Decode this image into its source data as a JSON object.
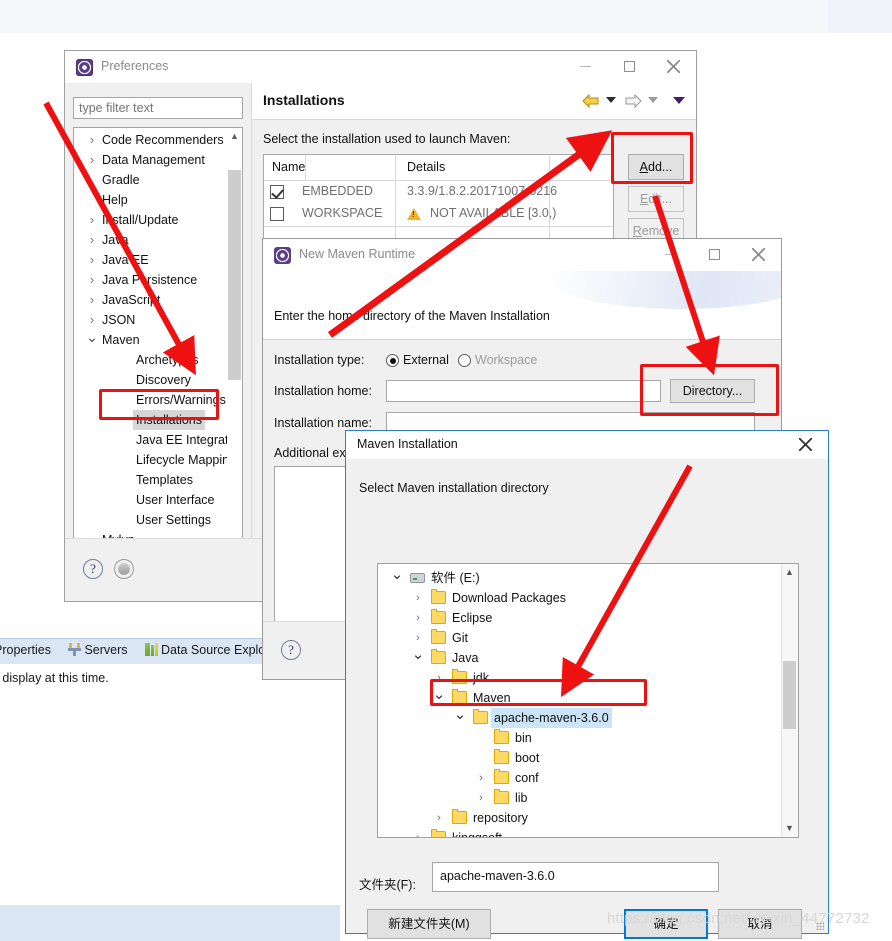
{
  "workbench": {
    "window_controls": [
      "restore-icon",
      "maximize-icon"
    ],
    "view_tabs": [
      {
        "label": "Properties",
        "icon": ""
      },
      {
        "label": "Servers",
        "icon": "servers-icon"
      },
      {
        "label": "Data Source Explo",
        "icon": "data-source-icon"
      }
    ],
    "view_message": "o display at this time."
  },
  "preferences": {
    "title": "Preferences",
    "icon": "preferences-icon",
    "filter_placeholder": "type filter text",
    "filter_value": "",
    "tree": [
      {
        "label": "Code Recommenders",
        "arrow": ">",
        "level": 1,
        "selected": false
      },
      {
        "label": "Data Management",
        "arrow": ">",
        "level": 1,
        "selected": false
      },
      {
        "label": "Gradle",
        "arrow": "",
        "level": 1,
        "selected": false
      },
      {
        "label": "Help",
        "arrow": "",
        "level": 1,
        "selected": false
      },
      {
        "label": "Install/Update",
        "arrow": ">",
        "level": 1,
        "selected": false
      },
      {
        "label": "Java",
        "arrow": ">",
        "level": 1,
        "selected": false
      },
      {
        "label": "Java EE",
        "arrow": ">",
        "level": 1,
        "selected": false
      },
      {
        "label": "Java Persistence",
        "arrow": ">",
        "level": 1,
        "selected": false
      },
      {
        "label": "JavaScript",
        "arrow": ">",
        "level": 1,
        "selected": false
      },
      {
        "label": "JSON",
        "arrow": ">",
        "level": 1,
        "selected": false
      },
      {
        "label": "Maven",
        "arrow": "v",
        "level": 1,
        "selected": false
      },
      {
        "label": "Archetypes",
        "arrow": "",
        "level": 2,
        "selected": false
      },
      {
        "label": "Discovery",
        "arrow": "",
        "level": 2,
        "selected": false
      },
      {
        "label": "Errors/Warnings",
        "arrow": "",
        "level": 2,
        "selected": false
      },
      {
        "label": "Installations",
        "arrow": "",
        "level": 2,
        "selected": true
      },
      {
        "label": "Java EE Integration",
        "arrow": "",
        "level": 2,
        "selected": false
      },
      {
        "label": "Lifecycle Mapping",
        "arrow": "",
        "level": 2,
        "selected": false
      },
      {
        "label": "Templates",
        "arrow": "",
        "level": 2,
        "selected": false
      },
      {
        "label": "User Interface",
        "arrow": "",
        "level": 2,
        "selected": false
      },
      {
        "label": "User Settings",
        "arrow": "",
        "level": 2,
        "selected": false
      },
      {
        "label": "Mylyn",
        "arrow": ">",
        "level": 1,
        "selected": false
      }
    ],
    "page": {
      "title": "Installations",
      "description": "Select the installation used to launch Maven:",
      "nav": {
        "back": "back-arrow-icon",
        "forward": "forward-arrow-icon",
        "menu": "dropdown-caret-icon"
      },
      "table": {
        "columns": [
          "Name",
          "Details"
        ],
        "rows": [
          {
            "checked": true,
            "name": "EMBEDDED",
            "details": "3.3.9/1.8.2.20171007-0216",
            "warning": false
          },
          {
            "checked": false,
            "name": "WORKSPACE",
            "details": "NOT AVAILABLE [3.0,)",
            "warning": true
          }
        ]
      },
      "buttons": [
        {
          "label": "Add...",
          "mnemonic": "A",
          "enabled": true
        },
        {
          "label": "Edit...",
          "mnemonic": "E",
          "enabled": false
        },
        {
          "label": "Remove",
          "mnemonic": "R",
          "enabled": false
        }
      ]
    },
    "footer": {
      "help": "?",
      "apply": "apply-icon"
    }
  },
  "new_maven_runtime": {
    "title": "New Maven Runtime",
    "icon": "maven-runtime-icon",
    "message": "Enter the home directory of the Maven Installation",
    "fields": {
      "installation_type_label": "Installation type:",
      "radio_external": "External",
      "radio_workspace": "Workspace",
      "selected_type": "External",
      "installation_home_label": "Installation home:",
      "installation_home_value": "",
      "installation_name_label": "Installation name:",
      "installation_name_value": "",
      "additional_label": "Additional ex",
      "directory_button": "Directory..."
    },
    "footer": {
      "help": "?"
    }
  },
  "maven_installation_dialog": {
    "title": "Maven Installation",
    "description": "Select Maven installation directory",
    "tree": [
      {
        "label": "软件 (E:)",
        "indent": 0,
        "expander": "v",
        "icon": "drive-icon",
        "selected": false
      },
      {
        "label": "Download Packages",
        "indent": 1,
        "expander": ">",
        "icon": "folder-icon",
        "selected": false
      },
      {
        "label": "Eclipse",
        "indent": 1,
        "expander": ">",
        "icon": "folder-icon",
        "selected": false
      },
      {
        "label": "Git",
        "indent": 1,
        "expander": ">",
        "icon": "folder-icon",
        "selected": false
      },
      {
        "label": "Java",
        "indent": 1,
        "expander": "v",
        "icon": "folder-icon",
        "selected": false
      },
      {
        "label": "jdk",
        "indent": 2,
        "expander": ">",
        "icon": "folder-icon",
        "selected": false
      },
      {
        "label": "Maven",
        "indent": 2,
        "expander": "v",
        "icon": "folder-icon",
        "selected": false
      },
      {
        "label": "apache-maven-3.6.0",
        "indent": 3,
        "expander": "v",
        "icon": "folder-icon",
        "selected": true
      },
      {
        "label": "bin",
        "indent": 4,
        "expander": "",
        "icon": "folder-icon",
        "selected": false
      },
      {
        "label": "boot",
        "indent": 4,
        "expander": "",
        "icon": "folder-icon",
        "selected": false
      },
      {
        "label": "conf",
        "indent": 4,
        "expander": ">",
        "icon": "folder-icon",
        "selected": false
      },
      {
        "label": "lib",
        "indent": 4,
        "expander": ">",
        "icon": "folder-icon",
        "selected": false
      },
      {
        "label": "repository",
        "indent": 2,
        "expander": ">",
        "icon": "folder-icon",
        "selected": false
      },
      {
        "label": "kinggsoft",
        "indent": 1,
        "expander": ">",
        "icon": "folder-icon",
        "selected": false
      }
    ],
    "folder_label": "文件夹(F):",
    "folder_value": "apache-maven-3.6.0",
    "buttons": {
      "new_folder": "新建文件夹(M)",
      "ok": "确定",
      "cancel": "取消"
    }
  },
  "annotations": {
    "watermark": "https://blog.csdn.net/weixin_44772732",
    "highlight_color": "#ee1111"
  }
}
